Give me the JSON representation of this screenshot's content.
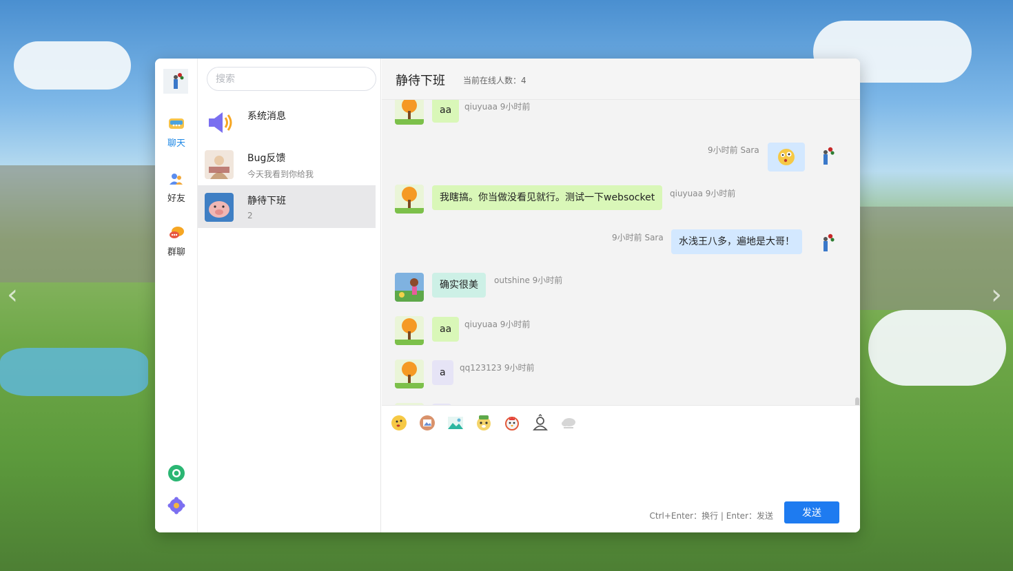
{
  "nav": {
    "items": [
      {
        "label": "聊天",
        "icon": "chat-bubble-icon",
        "active": true
      },
      {
        "label": "好友",
        "icon": "friends-icon",
        "active": false
      },
      {
        "label": "群聊",
        "icon": "group-chat-icon",
        "active": false
      }
    ],
    "bottom_icons": [
      "shutter-icon",
      "settings-gear-icon"
    ]
  },
  "search": {
    "placeholder": "搜索"
  },
  "conversations": [
    {
      "name": "系统消息",
      "subtitle": "",
      "icon": "speaker-icon"
    },
    {
      "name": "Bug反馈",
      "subtitle": "今天我看到你给我",
      "icon": "avatar"
    },
    {
      "name": "静待下班",
      "subtitle": "2",
      "icon": "avatar",
      "active": true
    }
  ],
  "chat": {
    "title": "静待下班",
    "online_label": "当前在线人数：",
    "online_count": "4"
  },
  "messages": [
    {
      "side": "left",
      "text": "aa",
      "meta": "qiuyuaa 9小时前"
    },
    {
      "side": "right",
      "text": "",
      "emoji": "surprised-face-emoji",
      "meta": "9小时前 Sara"
    },
    {
      "side": "left",
      "text": "我瞎搞。你当做没看见就行。测试一下websocket",
      "meta": "qiuyuaa 9小时前"
    },
    {
      "side": "right",
      "text": "水浅王八多，遍地是大哥！",
      "meta": "9小时前 Sara"
    },
    {
      "side": "left",
      "text": "确实很美",
      "meta": "outshine 9小时前"
    },
    {
      "side": "left",
      "text": "aa",
      "meta": "qiuyuaa 9小时前"
    },
    {
      "side": "left",
      "text": "a",
      "meta": "qq123123 9小时前"
    }
  ],
  "composer": {
    "tools": [
      "emoji-icon",
      "image-icon",
      "landscape-icon",
      "animal-icon",
      "chicken-icon",
      "user-card-icon",
      "cloud-icon"
    ],
    "hint": "Ctrl+Enter：换行 | Enter：发送",
    "send_label": "发送"
  },
  "colors": {
    "accent": "#1e7bf0",
    "bubble_green": "#d9f7b8",
    "bubble_blue": "#d3e8ff",
    "bubble_teal": "#cdf0e6",
    "bubble_lavender": "#e6e4f6"
  }
}
